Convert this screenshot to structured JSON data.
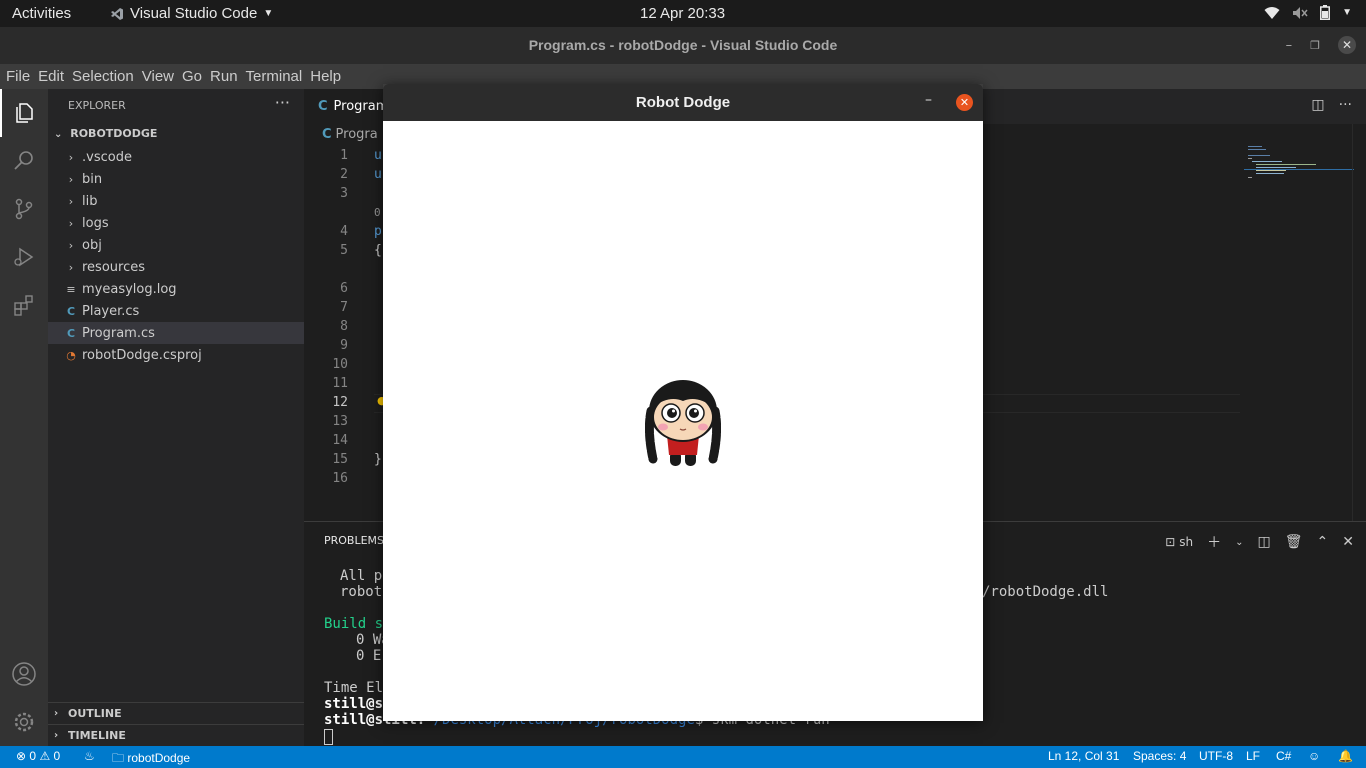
{
  "topbar": {
    "activities": "Activities",
    "app_name": "Visual Studio Code",
    "clock": "12 Apr  20:33"
  },
  "window": {
    "title": "Program.cs - robotDodge - Visual Studio Code"
  },
  "menu": [
    "File",
    "Edit",
    "Selection",
    "View",
    "Go",
    "Run",
    "Terminal",
    "Help"
  ],
  "sidebar": {
    "header": "EXPLORER",
    "project": "ROBOTDODGE",
    "items": [
      {
        "label": ".vscode",
        "type": "folder"
      },
      {
        "label": "bin",
        "type": "folder"
      },
      {
        "label": "lib",
        "type": "folder"
      },
      {
        "label": "logs",
        "type": "folder"
      },
      {
        "label": "obj",
        "type": "folder"
      },
      {
        "label": "resources",
        "type": "folder"
      },
      {
        "label": "myeasylog.log",
        "type": "log"
      },
      {
        "label": "Player.cs",
        "type": "csharp"
      },
      {
        "label": "Program.cs",
        "type": "csharp",
        "selected": true
      },
      {
        "label": "robotDodge.csproj",
        "type": "rss"
      }
    ],
    "outline": "OUTLINE",
    "timeline": "TIMELINE"
  },
  "editor": {
    "tab": "Program",
    "breadcrumb": "Progra",
    "line_numbers": [
      "1",
      "2",
      "3",
      "4",
      "5",
      "6",
      "7",
      "8",
      "9",
      "10",
      "11",
      "12",
      "13",
      "14",
      "15",
      "16"
    ],
    "code_fragments": {
      "line1": "u",
      "line2": "u",
      "codelens": "0",
      "line4": "p",
      "line5": "{",
      "line15": "}"
    },
    "current_line": "12"
  },
  "panel": {
    "tab": "PROBLEMS",
    "shell": "sh",
    "terminal": {
      "l1": "All p",
      "l2": "robotl",
      "l2_tail": "/robotDodge.dll",
      "build": "Build su",
      "warn": "0 Wa",
      "err": "0 E",
      "time": "Time Ela",
      "prompt1": "still@st",
      "prompt2_user": "still@still:",
      "prompt2_path": "~/Desktop/Attach/Proj/robotDodge",
      "prompt2_cmd": "$ skm dotnet run"
    }
  },
  "statusbar": {
    "errors": "0",
    "warnings": "0",
    "folder": "robotDodge",
    "position": "Ln 12, Col 31",
    "spaces": "Spaces: 4",
    "encoding": "UTF-8",
    "eol": "LF",
    "language": "C#"
  },
  "game": {
    "title": "Robot Dodge"
  },
  "colors": {
    "accent": "#007acc",
    "game_close": "#e9541f",
    "terminal_green": "#23d18b"
  }
}
